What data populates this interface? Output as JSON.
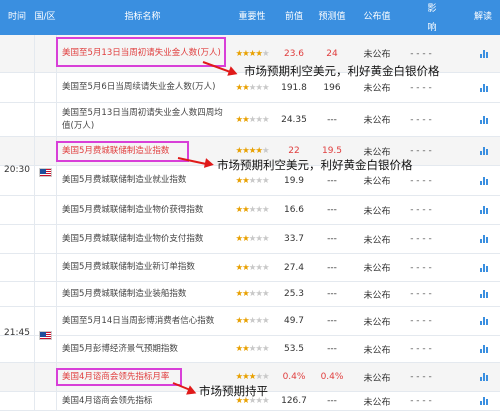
{
  "header": {
    "time": "时间",
    "region": "国/区",
    "name": "指标名称",
    "importance": "重要性",
    "prev": "前值",
    "forecast": "预测值",
    "actual": "公布值",
    "impact_line1": "影",
    "impact_line2": "响",
    "explain": "解读"
  },
  "groups": [
    {
      "time": "20:30",
      "country": "美国"
    },
    {
      "time": "21:45",
      "country": "美国"
    }
  ],
  "rows": [
    {
      "name": "美国至5月13日当周初请失业金人数(万人)",
      "stars": 4,
      "prev": "23.6",
      "forecast": "24",
      "actual": "未公布",
      "impact": "- - - -"
    },
    {
      "name": "美国至5月6日当周续请失业金人数(万人)",
      "stars": 2,
      "prev": "191.8",
      "forecast": "196",
      "actual": "未公布",
      "impact": "- - - -"
    },
    {
      "name": "美国至5月13日当周初请失业金人数四周均值(万人)",
      "stars": 2,
      "prev": "24.35",
      "forecast": "---",
      "actual": "未公布",
      "impact": "- - - -"
    },
    {
      "name": "美国5月费城联储制造业指数",
      "stars": 4,
      "prev": "22",
      "forecast": "19.5",
      "actual": "未公布",
      "impact": "- - - -"
    },
    {
      "name": "美国5月费城联储制造业就业指数",
      "stars": 2,
      "prev": "19.9",
      "forecast": "---",
      "actual": "未公布",
      "impact": "- - - -"
    },
    {
      "name": "美国5月费城联储制造业物价获得指数",
      "stars": 2,
      "prev": "16.6",
      "forecast": "---",
      "actual": "未公布",
      "impact": "- - - -"
    },
    {
      "name": "美国5月费城联储制造业物价支付指数",
      "stars": 2,
      "prev": "33.7",
      "forecast": "---",
      "actual": "未公布",
      "impact": "- - - -"
    },
    {
      "name": "美国5月费城联储制造业新订单指数",
      "stars": 2,
      "prev": "27.4",
      "forecast": "---",
      "actual": "未公布",
      "impact": "- - - -"
    },
    {
      "name": "美国5月费城联储制造业装船指数",
      "stars": 2,
      "prev": "25.3",
      "forecast": "---",
      "actual": "未公布",
      "impact": "- - - -"
    },
    {
      "name": "美国至5月14日当周彭博消费者信心指数",
      "stars": 2,
      "prev": "49.7",
      "forecast": "---",
      "actual": "未公布",
      "impact": "- - - -"
    },
    {
      "name": "美国5月彭博经济景气预期指数",
      "stars": 2,
      "prev": "53.5",
      "forecast": "---",
      "actual": "未公布",
      "impact": "- - - -"
    },
    {
      "name": "美国4月谘商会领先指标月率",
      "stars": 3,
      "prev": "0.4%",
      "forecast": "0.4%",
      "actual": "未公布",
      "impact": "- - - -"
    },
    {
      "name": "美国4月谘商会领先指标",
      "stars": 2,
      "prev": "126.7",
      "forecast": "---",
      "actual": "未公布",
      "impact": "- - - -"
    }
  ],
  "annotations": [
    "市场预期利空美元，利好黄金白银价格",
    "市场预期利空美元，利好黄金白银价格",
    "市场预期持平"
  ],
  "colors": {
    "header": "#3a8fe0",
    "highlight": "#e03e3e",
    "box": "#d83fd8",
    "arrow": "#e01a1a",
    "star": "#e8a000"
  }
}
